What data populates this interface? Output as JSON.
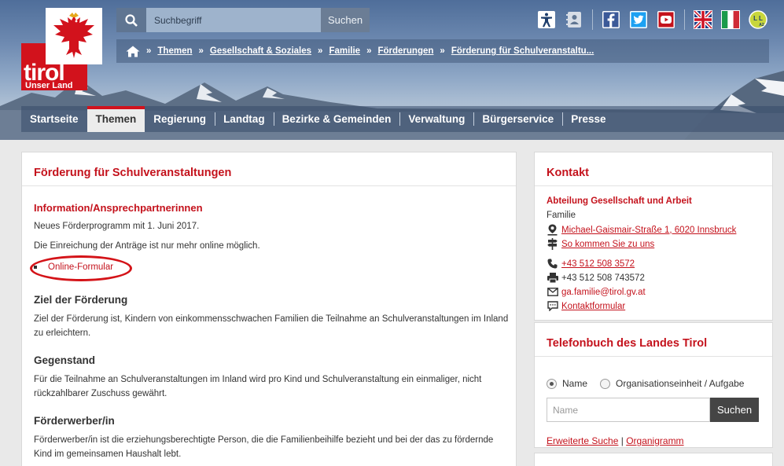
{
  "logo": {
    "word": "tirol",
    "subtitle": "Unser Land"
  },
  "search": {
    "placeholder": "Suchbegriff",
    "button": "Suchen"
  },
  "breadcrumb": [
    "Themen",
    "Gesellschaft & Soziales",
    "Familie",
    "Förderungen",
    "Förderung für Schulveranstaltu..."
  ],
  "breadcrumb_separator": "»",
  "service_icons": [
    "accessibility-icon",
    "contact-card-icon",
    "facebook-icon",
    "twitter-icon",
    "youtube-icon",
    "flag-uk-icon",
    "flag-italy-icon",
    "easy-language-icon"
  ],
  "nav": {
    "items": [
      "Startseite",
      "Themen",
      "Regierung",
      "Landtag",
      "Bezirke & Gemeinden",
      "Verwaltung",
      "Bürgerservice",
      "Presse"
    ],
    "active": "Themen"
  },
  "main": {
    "title": "Förderung für Schulveranstaltungen",
    "info_heading": "Information/Ansprechpartnerinnen",
    "info_p1": "Neues Förderprogramm mit 1. Juni 2017.",
    "info_p2": "Die Einreichung der Anträge ist nur mehr online möglich.",
    "online_link": "Online-Formular",
    "ziel_heading": "Ziel der Förderung",
    "ziel_text": "Ziel der Förderung ist, Kindern von einkommensschwachen Familien die Teilnahme an Schulveranstaltungen im Inland zu erleichtern.",
    "gegenstand_heading": "Gegenstand",
    "gegenstand_text": "Für die Teilnahme an Schulveranstaltungen im Inland wird pro Kind und Schulveranstaltung ein einmaliger, nicht rückzahlbarer Zuschuss gewährt.",
    "foerderwerber_heading": "Förderwerber/in",
    "foerderwerber_text": "Förderwerber/in ist die erziehungsberechtigte Person, die die Familienbeihilfe bezieht und bei der das zu fördernde Kind im gemeinsamen Haushalt lebt."
  },
  "kontakt": {
    "title": "Kontakt",
    "department": "Abteilung Gesellschaft und Arbeit",
    "sub": "Familie",
    "address": "Michael-Gaismair-Straße 1, 6020 Innsbruck",
    "directions": "So kommen Sie zu uns",
    "phone": "+43 512 508 3572",
    "fax": "+43 512 508 743572",
    "email": "ga.familie@tirol.gv.at",
    "form": "Kontaktformular"
  },
  "phonebook": {
    "title": "Telefonbuch des Landes Tirol",
    "radio_name": "Name",
    "radio_org": "Organisationseinheit / Aufgabe",
    "input_placeholder": "Name",
    "button": "Suchen",
    "link_advanced": "Erweiterte Suche",
    "link_separator": "|",
    "link_organigram": "Organigramm"
  },
  "colors": {
    "brand_red": "#d2121c",
    "link_red": "#c4121c"
  }
}
